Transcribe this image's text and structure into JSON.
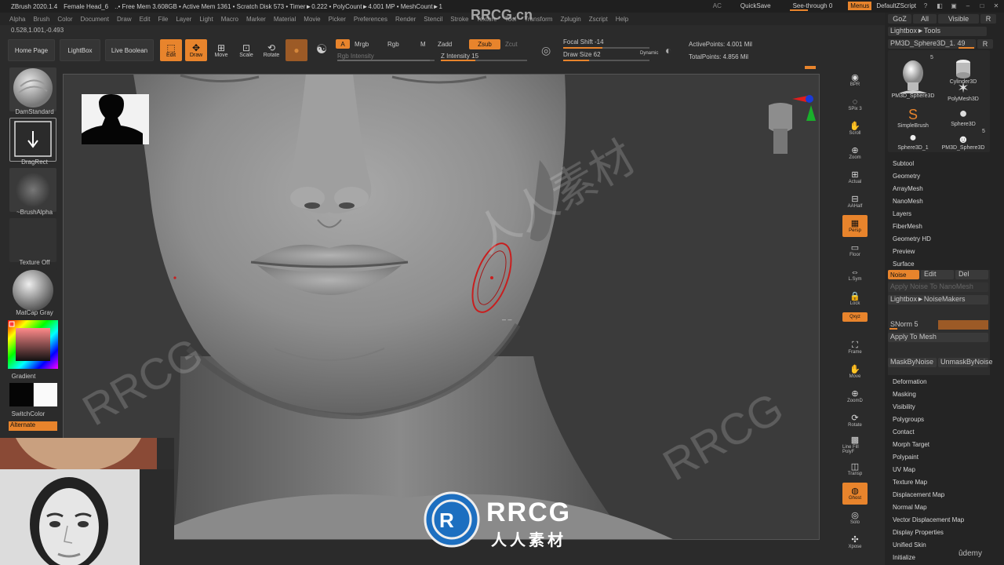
{
  "titlebar": {
    "app": "ZBrush 2020.1.4",
    "doc": "Female Head_6",
    "stats": "..• Free Mem 3.608GB • Active Mem 1361 • Scratch Disk 573 • Timer►0.222 • PolyCount►4.001 MP • MeshCount►1",
    "ac": "AC",
    "quicksave": "QuickSave",
    "see_through": "See-through  0",
    "menus": "Menus",
    "script": "DefaultZScript"
  },
  "menubar": [
    "Alpha",
    "Brush",
    "Color",
    "Document",
    "Draw",
    "Edit",
    "File",
    "Layer",
    "Light",
    "Macro",
    "Marker",
    "Material",
    "Movie",
    "Picker",
    "Preferences",
    "Render",
    "Stencil",
    "Stroke",
    "Texture",
    "Tool",
    "Transform",
    "Zplugin",
    "Zscript",
    "Help"
  ],
  "coords": "0.528,1.001,-0.493",
  "toolbar": {
    "home": "Home Page",
    "lightbox": "LightBox",
    "live_boolean": "Live Boolean",
    "edit": "Edit",
    "draw": "Draw",
    "move": "Move",
    "scale": "Scale",
    "rotate": "Rotate",
    "a": "A",
    "mrgb": "Mrgb",
    "rgb": "Rgb",
    "m": "M",
    "zadd": "Zadd",
    "zsub": "Zsub",
    "zcut": "Zcut",
    "rgb_intensity": "Rgb Intensity",
    "z_intensity": "Z Intensity 15",
    "focal_shift": "Focal Shift -14",
    "draw_size": "Draw Size 62",
    "dynamic": "Dynamic",
    "active_points": "ActivePoints: 4.001 Mil",
    "total_points": "TotalPoints: 4.856 Mil"
  },
  "leftshelf": {
    "brush": "DamStandard",
    "stroke": "DragRect",
    "alpha": "~BrushAlpha",
    "texture": "Texture Off",
    "material": "MatCap Gray",
    "gradient": "Gradient",
    "switchcolor": "SwitchColor",
    "alternate": "Alternate"
  },
  "rightshelf": [
    {
      "label": "BPR",
      "icon": "render-icon"
    },
    {
      "label": "SPix 3",
      "icon": "spix-icon"
    },
    {
      "label": "Scroll",
      "icon": "hand-icon"
    },
    {
      "label": "Zoom",
      "icon": "zoom-icon"
    },
    {
      "label": "Actual",
      "icon": "actual-icon"
    },
    {
      "label": "AAHalf",
      "icon": "aahalf-icon"
    },
    {
      "label": "Persp",
      "icon": "persp-icon"
    },
    {
      "label": "Floor",
      "icon": "floor-icon"
    },
    {
      "label": "L.Sym",
      "icon": "lsym-icon"
    },
    {
      "label": "Lock",
      "icon": "lock-icon"
    },
    {
      "label": "Qxyz",
      "icon": "xyz-icon"
    },
    {
      "label": "Frame",
      "icon": "frame-icon"
    },
    {
      "label": "Move",
      "icon": "move-icon"
    },
    {
      "label": "ZoomD",
      "icon": "zoom3d-icon"
    },
    {
      "label": "Rotate",
      "icon": "rotate-icon"
    },
    {
      "label": "Line Fill PolyF",
      "icon": "polyf-icon"
    },
    {
      "label": "Transp",
      "icon": "transp-icon"
    },
    {
      "label": "Ghost",
      "icon": "ghost-icon"
    },
    {
      "label": "Solo",
      "icon": "solo-icon"
    },
    {
      "label": "Xpose",
      "icon": "xpose-icon"
    }
  ],
  "palette": {
    "goz": "GoZ",
    "all": "All",
    "visible": "Visible",
    "r": "R",
    "lightbox_tools": "Lightbox►Tools",
    "current_tool": "PM3D_Sphere3D_1. 49",
    "tools": [
      {
        "name": "PM3D_Sphere3D",
        "badge": "5"
      },
      {
        "name": "Cylinder3D",
        "badge": ""
      },
      {
        "name": "SimpleBrush",
        "badge": ""
      },
      {
        "name": "PolyMesh3D",
        "badge": ""
      },
      {
        "name": "Sphere3D",
        "badge": ""
      },
      {
        "name": "Sphere3D_1",
        "badge": ""
      },
      {
        "name": "PM3D_Sphere3D",
        "badge": "5"
      }
    ],
    "sections_top": [
      "Subtool",
      "Geometry",
      "ArrayMesh",
      "NanoMesh",
      "Layers",
      "FiberMesh",
      "Geometry HD",
      "Preview",
      "Surface"
    ],
    "noise": "Noise",
    "edit": "Edit",
    "del": "Del",
    "apply_noise_nano": "Apply Noise To NanoMesh",
    "lightbox_noise": "Lightbox►NoiseMakers",
    "snorm": "SNorm 5",
    "apply_to_mesh": "Apply To Mesh",
    "mask_by_noise": "MaskByNoise",
    "unmask_by_noise": "UnmaskByNoise",
    "sections_bottom": [
      "Deformation",
      "Masking",
      "Visibility",
      "Polygroups",
      "Contact",
      "Morph Target",
      "Polypaint",
      "UV Map",
      "Texture Map",
      "Displacement Map",
      "Normal Map",
      "Vector Displacement Map",
      "Display Properties",
      "Unified Skin",
      "Initialize"
    ]
  },
  "watermark": {
    "top": "RRCG.cn",
    "brand": "RRCG",
    "sub": "人人素材"
  },
  "udemy": "ûdemy",
  "colors": {
    "accent": "#e8842c",
    "bg": "#2b2b2b",
    "panel": "#242424"
  }
}
